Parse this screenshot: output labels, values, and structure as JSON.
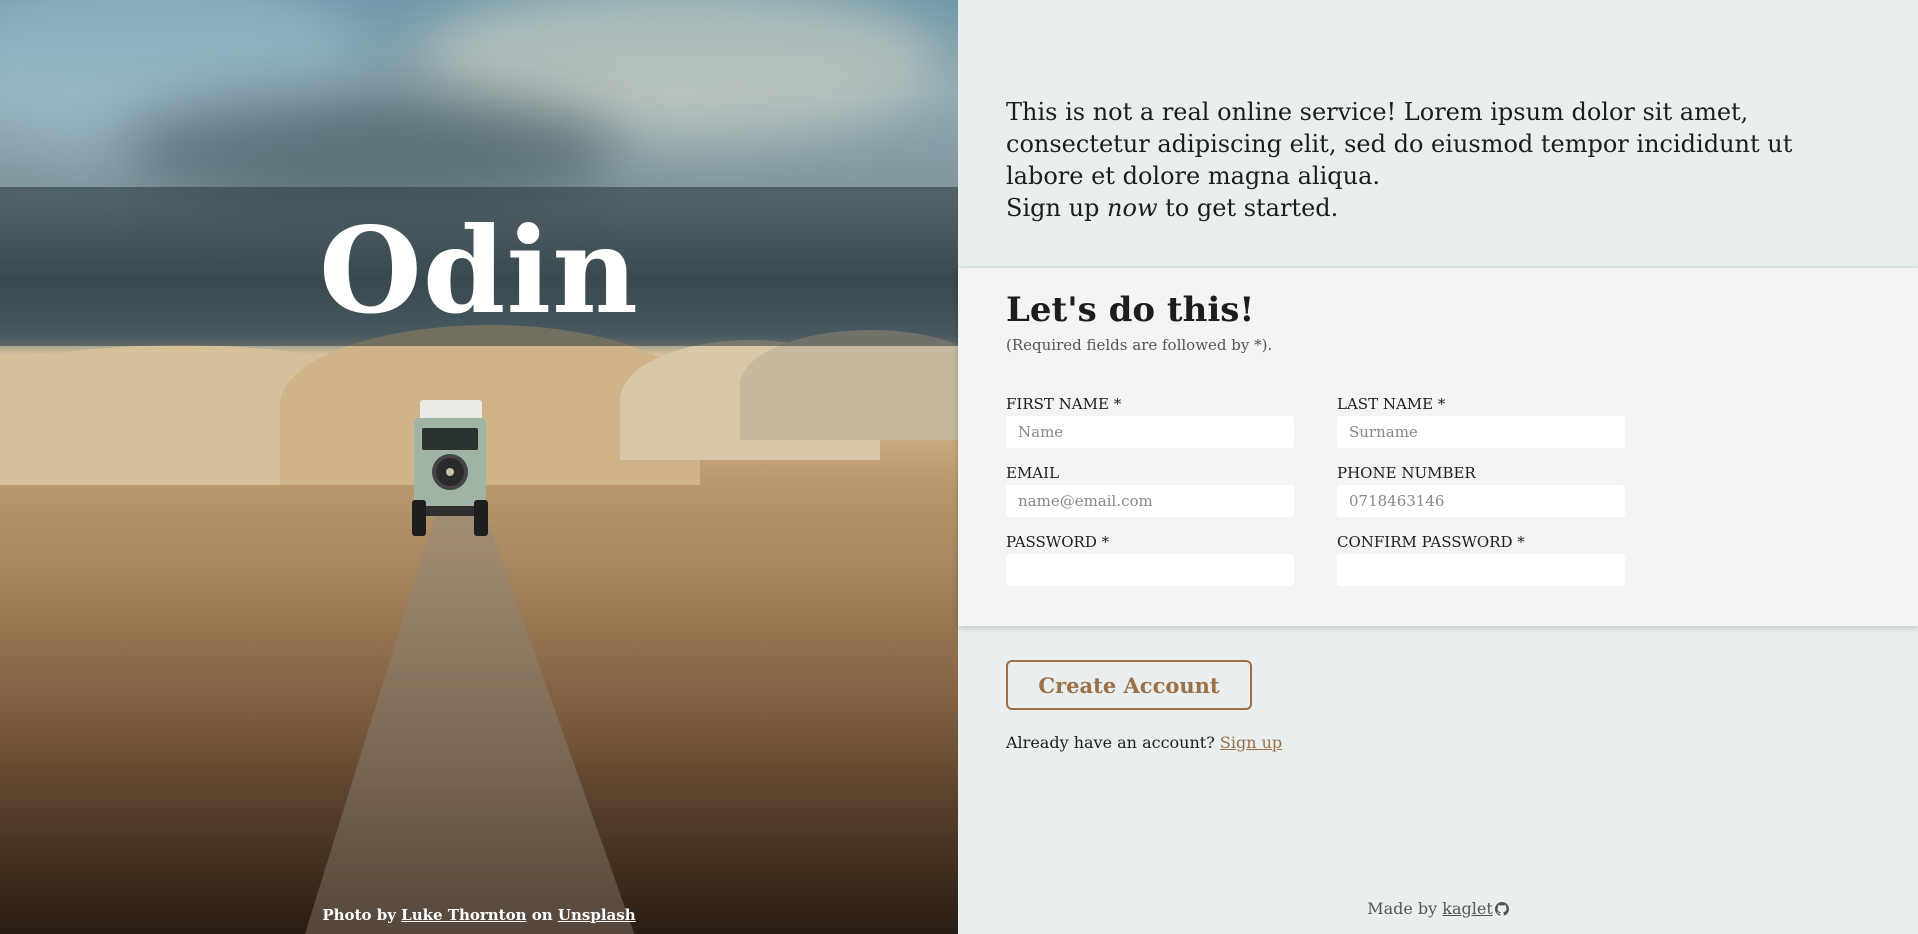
{
  "hero": {
    "brand": "Odin",
    "credit": {
      "prefix": "Photo by",
      "author": "Luke Thornton",
      "middle": "on",
      "site": "Unsplash"
    }
  },
  "intro": {
    "paragraph": "This is not a real online service! Lorem ipsum dolor sit amet, consectetur adipiscing elit, sed do eiusmod tempor incididunt ut labore et dolore magna aliqua.",
    "cta_before": "Sign up",
    "cta_emphasis": "now",
    "cta_after": "to get started."
  },
  "form": {
    "title": "Let's do this!",
    "subtitle": "(Required fields are followed by *).",
    "fields": {
      "first_name": {
        "label": "FIRST NAME *",
        "placeholder": "Name",
        "value": ""
      },
      "last_name": {
        "label": "LAST NAME *",
        "placeholder": "Surname",
        "value": ""
      },
      "email": {
        "label": "EMAIL",
        "placeholder": "name@email.com",
        "value": ""
      },
      "phone": {
        "label": "PHONE NUMBER",
        "placeholder": "0718463146",
        "value": ""
      },
      "password": {
        "label": "PASSWORD *",
        "placeholder": "",
        "value": ""
      },
      "confirm_password": {
        "label": "CONFIRM PASSWORD *",
        "placeholder": "",
        "value": ""
      }
    },
    "submit_label": "Create Account"
  },
  "signin": {
    "prompt": "Already have an account?",
    "link": "Sign up"
  },
  "footer": {
    "prefix": "Made by",
    "author": "kaglet",
    "icon": "github-icon"
  },
  "colors": {
    "accent": "#9d6f45",
    "panel_bg": "#e9efef",
    "card_bg": "#f4f4f4",
    "text": "#1d1d1d"
  }
}
